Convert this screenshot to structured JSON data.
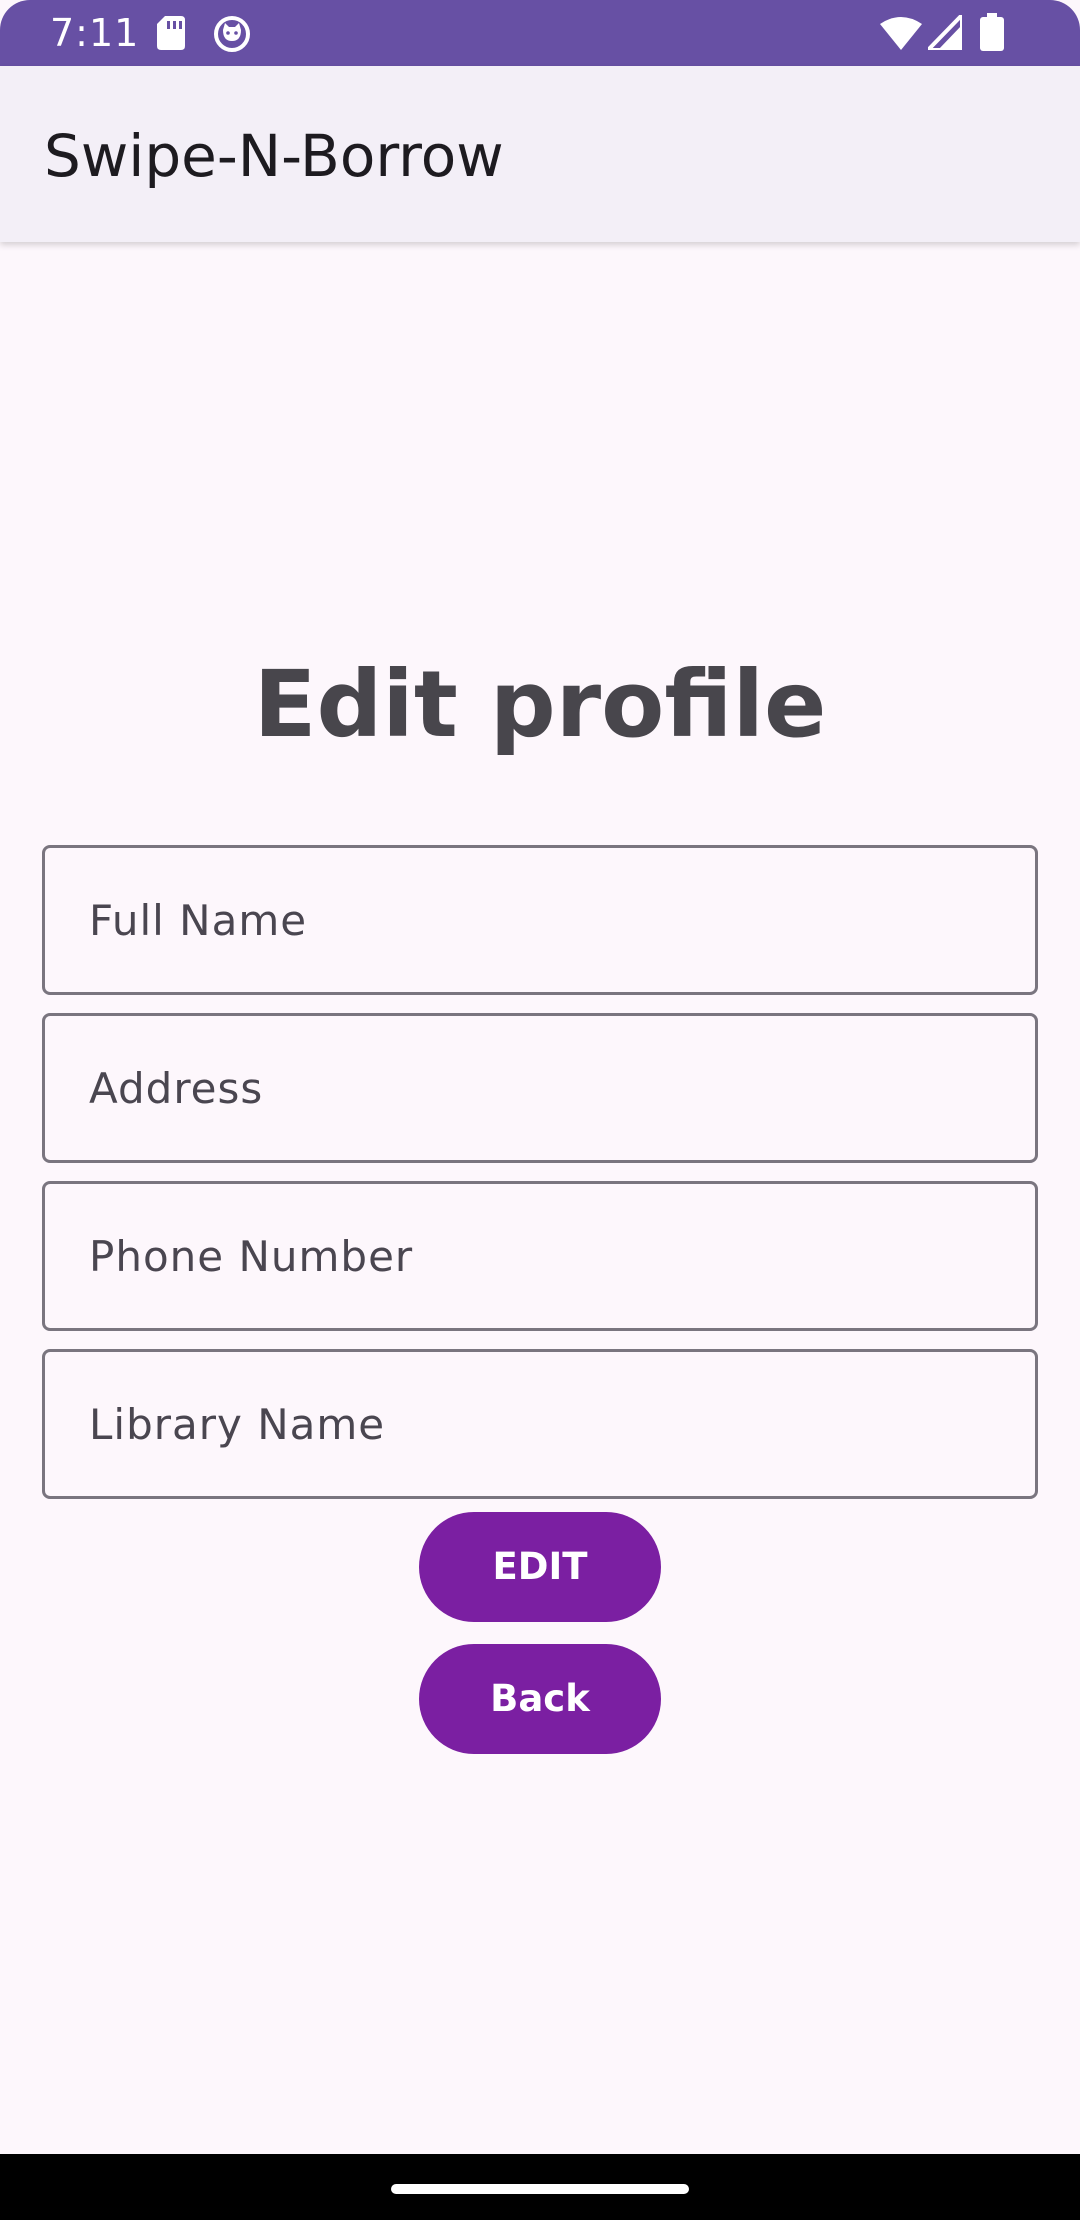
{
  "status_bar": {
    "time": "7:11",
    "icons": [
      "sd-card-icon",
      "cat-notification-icon",
      "wifi-icon",
      "cell-signal-icon",
      "battery-icon"
    ],
    "color": "#6750a4"
  },
  "app_bar": {
    "title": "Swipe-N-Borrow"
  },
  "main": {
    "heading": "Edit profile",
    "fields": {
      "full_name": {
        "placeholder": "Full Name",
        "value": ""
      },
      "address": {
        "placeholder": "Address",
        "value": ""
      },
      "phone_number": {
        "placeholder": "Phone Number",
        "value": ""
      },
      "library_name": {
        "placeholder": "Library Name",
        "value": ""
      }
    },
    "buttons": {
      "edit_label": "EDIT",
      "back_label": "Back"
    }
  },
  "colors": {
    "accent": "#7b1fa2",
    "background": "#fdf7fc",
    "app_bar": "#f3eff7"
  }
}
